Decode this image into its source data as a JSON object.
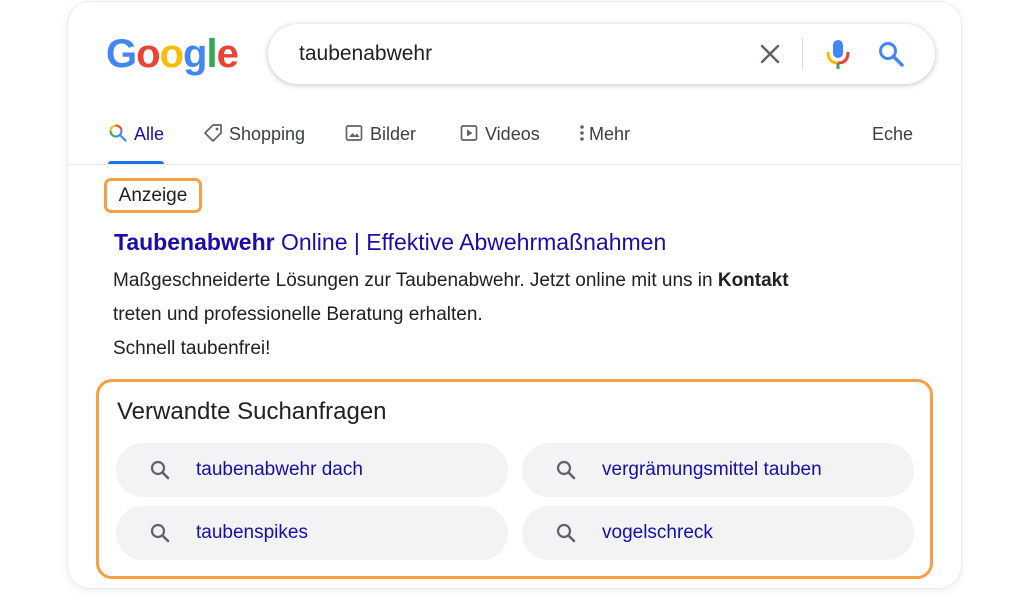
{
  "logo": {
    "letters": [
      "G",
      "o",
      "o",
      "g",
      "l",
      "e"
    ],
    "colors": [
      "#4285F4",
      "#EA4335",
      "#FBBC05",
      "#4285F4",
      "#34A853",
      "#EA4335"
    ]
  },
  "search": {
    "query": "taubenabwehr"
  },
  "tabs": [
    {
      "label": "Alle",
      "icon": "search-icon",
      "active": true
    },
    {
      "label": "Shopping",
      "icon": "tag-icon"
    },
    {
      "label": "Bilder",
      "icon": "image-icon"
    },
    {
      "label": "Videos",
      "icon": "video-icon"
    },
    {
      "label": "Mehr",
      "icon": "more-vert-icon"
    },
    {
      "label": "Eche",
      "icon": ""
    }
  ],
  "ad": {
    "badge": "Anzeige",
    "title_bold": "Taubenabwehr",
    "title_rest": " Online | Effektive Abwehrmaßnahmen",
    "desc_line1_pre": "Maßgeschneiderte Lösungen zur Taubenabwehr. Jetzt online mit uns  in ",
    "desc_line1_bold": "Kontakt",
    "desc_line2": "treten und professionelle Beratung erhalten.",
    "desc_line3": "Schnell taubenfrei!"
  },
  "related": {
    "title": "Verwandte Suchanfragen",
    "items": [
      "taubenabwehr dach",
      "vergrämungsmittel tauben",
      "taubenspikes",
      "vogelschreck"
    ]
  },
  "colors": {
    "link": "#1a0dab",
    "accent": "#1a73e8",
    "highlight": "#f4a043",
    "chip_bg": "#f1f3f4"
  }
}
